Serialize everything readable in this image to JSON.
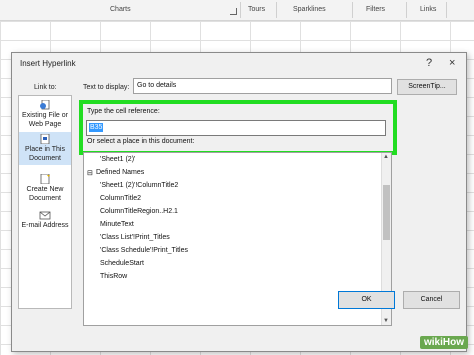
{
  "ribbon": {
    "groups": [
      "Charts",
      "Tours",
      "Sparklines",
      "Filters",
      "Links"
    ]
  },
  "dialog": {
    "title": "Insert Hyperlink",
    "help_label": "?",
    "close_label": "×",
    "link_to_label": "Link to:",
    "link_to_items": [
      {
        "label": "Existing File or Web Page",
        "icon": "globe-file-icon"
      },
      {
        "label": "Place in This Document",
        "icon": "document-place-icon"
      },
      {
        "label": "Create New Document",
        "icon": "new-document-icon"
      },
      {
        "label": "E-mail Address",
        "icon": "email-icon"
      }
    ],
    "text_to_display_label": "Text to display:",
    "text_to_display_value": "Go to details",
    "screentip_label": "ScreenTip...",
    "cell_reference_label": "Type the cell reference:",
    "cell_reference_value": "B35",
    "select_place_label": "Or select a place in this document:",
    "tree": [
      {
        "text": "'Sheet1 (2)'",
        "indent": 1
      },
      {
        "text": "Defined Names",
        "indent": 0,
        "toggle": "⊟"
      },
      {
        "text": "'Sheet1 (2)'!ColumnTitle2",
        "indent": 1
      },
      {
        "text": "ColumnTitle2",
        "indent": 1
      },
      {
        "text": "ColumnTitleRegion..H2.1",
        "indent": 1
      },
      {
        "text": "MinuteText",
        "indent": 1
      },
      {
        "text": "'Class List'!Print_Titles",
        "indent": 1
      },
      {
        "text": "'Class Schedule'!Print_Titles",
        "indent": 1
      },
      {
        "text": "ScheduleStart",
        "indent": 1
      },
      {
        "text": "ThisRow",
        "indent": 1
      }
    ],
    "ok_label": "OK",
    "cancel_label": "Cancel"
  },
  "watermark": "wikiHow",
  "colors": {
    "highlight": "#22dd22",
    "selection": "#3399ff"
  }
}
